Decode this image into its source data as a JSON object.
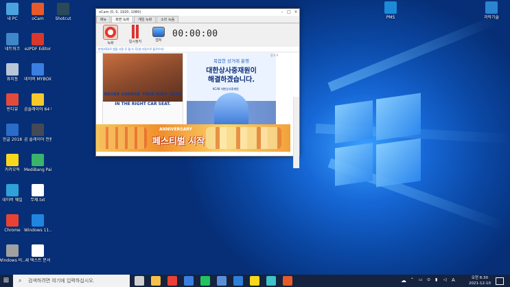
{
  "desktop_icons_left": [
    {
      "label": "내 PC",
      "color": "#4aa3df"
    },
    {
      "label": "네트워크",
      "color": "#3f87c8"
    },
    {
      "label": "휴지통",
      "color": "#b8c6d8"
    },
    {
      "label": "반디뷰",
      "color": "#e14b3b"
    },
    {
      "label": "한글 2018",
      "color": "#2a6cc8"
    },
    {
      "label": "카카오톡",
      "color": "#f9d71c"
    },
    {
      "label": "네이버 웨일",
      "color": "#2fa0d8"
    },
    {
      "label": "Chrome",
      "color": "#e94235"
    },
    {
      "label": "Windows 비...",
      "color": "#a0a0a0"
    }
  ],
  "desktop_icons_col2": [
    {
      "label": "oCam",
      "color": "#e65a2a"
    },
    {
      "label": "ezPDF Editor",
      "color": "#d8382a"
    },
    {
      "label": "네이버 MYBOX",
      "color": "#3a7fe0"
    },
    {
      "label": "곰플레이어 64 비트",
      "color": "#f6c829"
    },
    {
      "label": "곰 플레이어 전원",
      "color": "#444a55"
    },
    {
      "label": "MediBang Paint Pro",
      "color": "#3ab36b"
    },
    {
      "label": "무제.txt",
      "color": "#ffffff"
    },
    {
      "label": "Windows 11...",
      "color": "#1f86e0"
    },
    {
      "label": "새 텍스트 문서",
      "color": "#ffffff"
    }
  ],
  "desktop_icons_col3": [
    {
      "label": "Shotcut",
      "color": "#2a4a5a"
    }
  ],
  "desktop_icons_right": [
    {
      "label": "PMS",
      "color": "#1d8ad8"
    },
    {
      "label": "과학기술",
      "color": "#2a84d0"
    }
  ],
  "ocam": {
    "title": "oCam (0, 0, 1920, 1080)",
    "tabs": [
      "메뉴",
      "화면 녹화",
      "게임 녹화",
      "소리 녹음"
    ],
    "toolbar": [
      {
        "label": "녹화",
        "icon": "record-icon"
      },
      {
        "label": "일시정지",
        "icon": "pause-icon"
      },
      {
        "label": "캡처",
        "icon": "capture-icon"
      }
    ],
    "timer": "00:00:00",
    "notice": "반대(AD)로 앱을 사용 후 월 녹 후(앱 자동으로 플로우되)",
    "ad_close": "광고 X",
    "ad1": {
      "line1": "NEVER CHANGE YOUR KIDS' SEAT",
      "line2": "IN THE RIGHT CAR SEAT."
    },
    "ad2": {
      "line1": "복잡한 상거래 분쟁",
      "line2": "대한상사중재원이",
      "line3": "해결하겠습니다.",
      "logo": "KCAB 대한상사중재원"
    },
    "ad3": {
      "line1": "ANNIVERSARY",
      "line2": "페스티벌 시작"
    }
  },
  "taskbar": {
    "search_placeholder": "검색하려면 여기에 입력하십시오.",
    "apps": [
      {
        "name": "task-view",
        "color": "#d0d0d0"
      },
      {
        "name": "file-explorer",
        "color": "#f5c04a"
      },
      {
        "name": "chrome",
        "color": "#e94235"
      },
      {
        "name": "app-18",
        "color": "#3a7fe0"
      },
      {
        "name": "line",
        "color": "#22c35e"
      },
      {
        "name": "store",
        "color": "#5a8fd8"
      },
      {
        "name": "mail",
        "color": "#2f7fd8"
      },
      {
        "name": "kakaotalk",
        "color": "#f9d71c"
      },
      {
        "name": "app-teal",
        "color": "#3ec3c8"
      },
      {
        "name": "ocam",
        "color": "#e65a2a"
      }
    ],
    "clock_time": "오전 6:30",
    "clock_date": "2021-12-10",
    "lang": "A"
  }
}
